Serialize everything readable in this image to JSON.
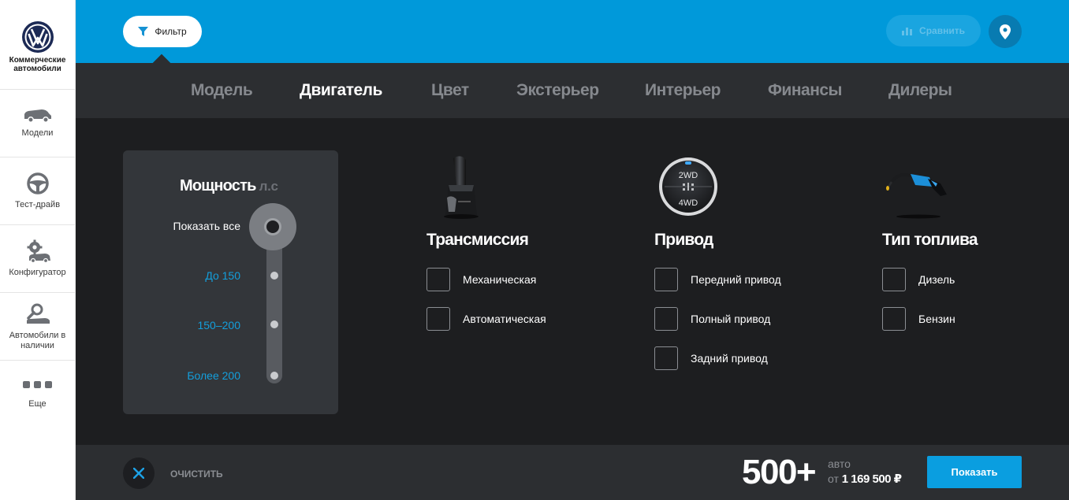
{
  "sidebar": {
    "brand": "Коммерческие автомобили",
    "items": [
      {
        "label": "Модели",
        "icon": "van-icon"
      },
      {
        "label": "Тест-драйв",
        "icon": "steering-wheel-icon"
      },
      {
        "label": "Конфигуратор",
        "icon": "car-gear-icon"
      },
      {
        "label": "Автомобили в наличии",
        "icon": "car-search-icon"
      }
    ],
    "more_label": "Еще"
  },
  "topbar": {
    "filter_label": "Фильтр",
    "compare_label": "Сравнить",
    "accent_color": "#0099da"
  },
  "tabs": [
    {
      "label": "Модель",
      "active": false
    },
    {
      "label": "Двигатель",
      "active": true
    },
    {
      "label": "Цвет",
      "active": false
    },
    {
      "label": "Экстерьер",
      "active": false
    },
    {
      "label": "Интерьер",
      "active": false
    },
    {
      "label": "Финансы",
      "active": false
    },
    {
      "label": "Дилеры",
      "active": false
    }
  ],
  "power": {
    "title": "Мощность",
    "unit": "л.с",
    "options": [
      "Показать все",
      "До 150",
      "150–200",
      "Более 200"
    ],
    "selected": "Показать все"
  },
  "transmission": {
    "title": "Трансмиссия",
    "options": [
      "Механическая",
      "Автоматическая"
    ]
  },
  "drive": {
    "title": "Привод",
    "dial_top": "2WD",
    "dial_bottom": "4WD",
    "options": [
      "Передний привод",
      "Полный привод",
      "Задний привод"
    ]
  },
  "fuel": {
    "title": "Тип топлива",
    "options": [
      "Дизель",
      "Бензин"
    ]
  },
  "bottom": {
    "clear_label": "ОЧИСТИТЬ",
    "count": "500+",
    "count_unit": "авто",
    "price_prefix": "от",
    "price": "1 169 500 ₽",
    "show_label": "Показать"
  }
}
